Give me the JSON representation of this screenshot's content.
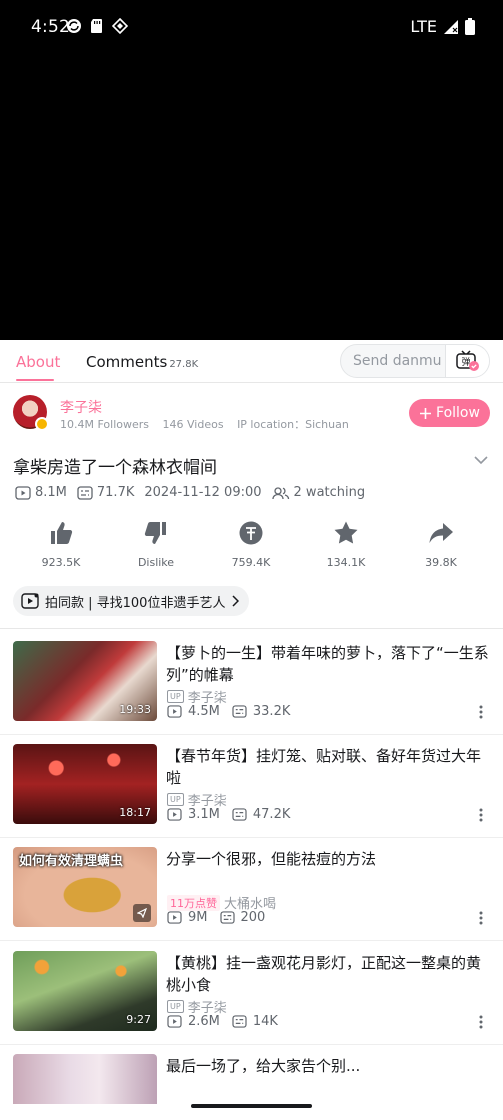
{
  "status_bar": {
    "time": "4:52",
    "network": "LTE"
  },
  "tabs": {
    "about": "About",
    "comments": "Comments",
    "comments_count": "27.8K"
  },
  "danmu": {
    "placeholder": "Send danmu",
    "button_glyph": "弹"
  },
  "uploader": {
    "name": "李子柒",
    "followers": "10.4M Followers",
    "videos": "146 Videos",
    "ip_location": "IP location：Sichuan",
    "follow_label": "Follow"
  },
  "video": {
    "title": "拿柴房造了一个森林衣帽间",
    "views": "8.1M",
    "danmaku": "71.7K",
    "date": "2024-11-12 09:00",
    "watching": "2 watching"
  },
  "actions": [
    {
      "icon": "like-icon",
      "label": "923.5K"
    },
    {
      "icon": "dislike-icon",
      "label": "Dislike"
    },
    {
      "icon": "coin-icon",
      "label": "759.4K"
    },
    {
      "icon": "favorite-icon",
      "label": "134.1K"
    },
    {
      "icon": "share-icon",
      "label": "39.8K"
    }
  ],
  "promo": {
    "label": "拍同款 | 寻找100位非遗手艺人"
  },
  "recommendations": [
    {
      "title": "【萝卜的一生】带着年味的萝卜，落下了“一生系列”的帷幕",
      "uploader": "李子柒",
      "duration": "19:33",
      "views": "4.5M",
      "danmaku": "33.2K"
    },
    {
      "title": "【春节年货】挂灯笼、贴对联、备好年货过大年啦",
      "uploader": "李子柒",
      "duration": "18:17",
      "views": "3.1M",
      "danmaku": "47.2K"
    },
    {
      "title": "分享一个很邪，但能祛痘的方法",
      "uploader": "大桶水喝",
      "hot_tag": "11万点赞",
      "thumb_text": "如何有效清理螨虫",
      "views": "9M",
      "danmaku": "200"
    },
    {
      "title": "【黄桃】挂一盏观花月影灯，正配这一整桌的黄桃小食",
      "uploader": "李子柒",
      "duration": "9:27",
      "views": "2.6M",
      "danmaku": "14K"
    },
    {
      "title": "最后一场了，给大家告个别..."
    }
  ],
  "colors": {
    "accent": "#fb7299",
    "text": "#18191c",
    "secondary": "#61666d"
  }
}
